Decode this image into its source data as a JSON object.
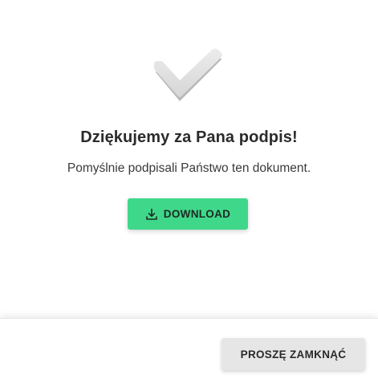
{
  "success": {
    "icon": "checkmark-icon",
    "title": "Dziękujemy za Pana podpis!",
    "message": "Pomyślnie podpisali Państwo ten dokument."
  },
  "download_button": {
    "icon": "download-icon",
    "label": "DOWNLOAD",
    "color": "#3fd88a"
  },
  "footer": {
    "close_label": "PROSZĘ ZAMKNĄĆ",
    "close_color": "#e6e6e6"
  }
}
